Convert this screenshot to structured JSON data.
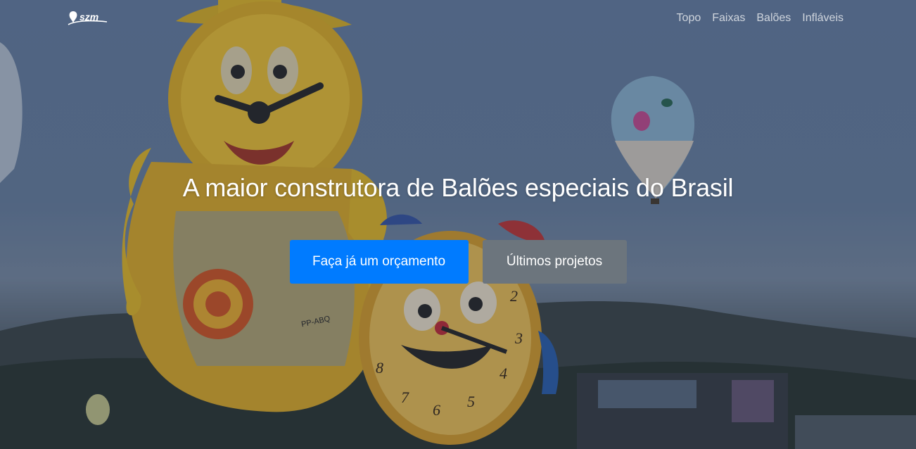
{
  "brand": {
    "logo_text": "szm"
  },
  "nav": {
    "items": [
      {
        "label": "Topo"
      },
      {
        "label": "Faixas"
      },
      {
        "label": "Balões"
      },
      {
        "label": "Infláveis"
      }
    ]
  },
  "hero": {
    "headline": "A maior construtora de Balões especiais do Brasil",
    "primary_cta": "Faça já um orçamento",
    "secondary_cta": "Últimos projetos",
    "balloon_text": "PP-ABQ",
    "clock_numbers": [
      "2",
      "3",
      "4",
      "5",
      "6",
      "7",
      "8"
    ]
  },
  "colors": {
    "primary": "#007bff",
    "secondary": "#6c757d",
    "text": "#ffffff"
  }
}
